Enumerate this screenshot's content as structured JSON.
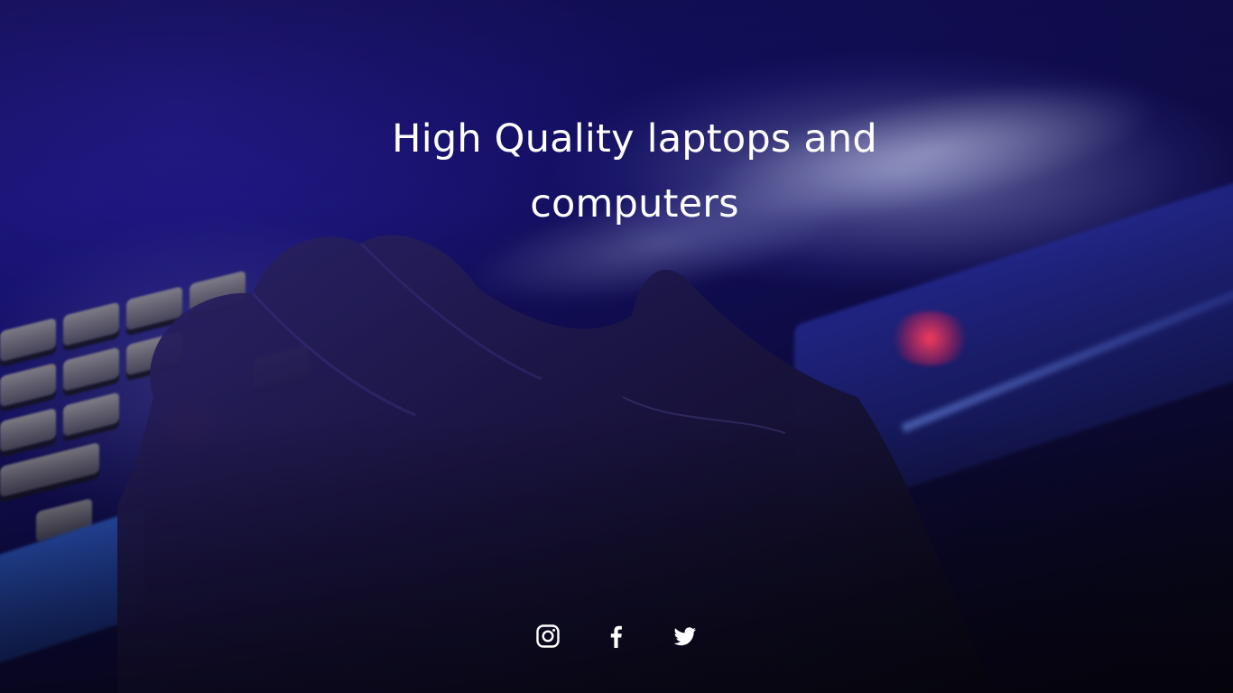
{
  "hero": {
    "headline": "High Quality laptops and computers"
  },
  "social": {
    "items": [
      {
        "icon": "instagram-icon"
      },
      {
        "icon": "facebook-icon"
      },
      {
        "icon": "twitter-icon"
      }
    ],
    "icon_color": "#ffffff"
  },
  "colors": {
    "background_primary": "#14106a",
    "background_dark": "#06050d",
    "accent_red": "#ff3c5a",
    "text": "#ffffff"
  }
}
